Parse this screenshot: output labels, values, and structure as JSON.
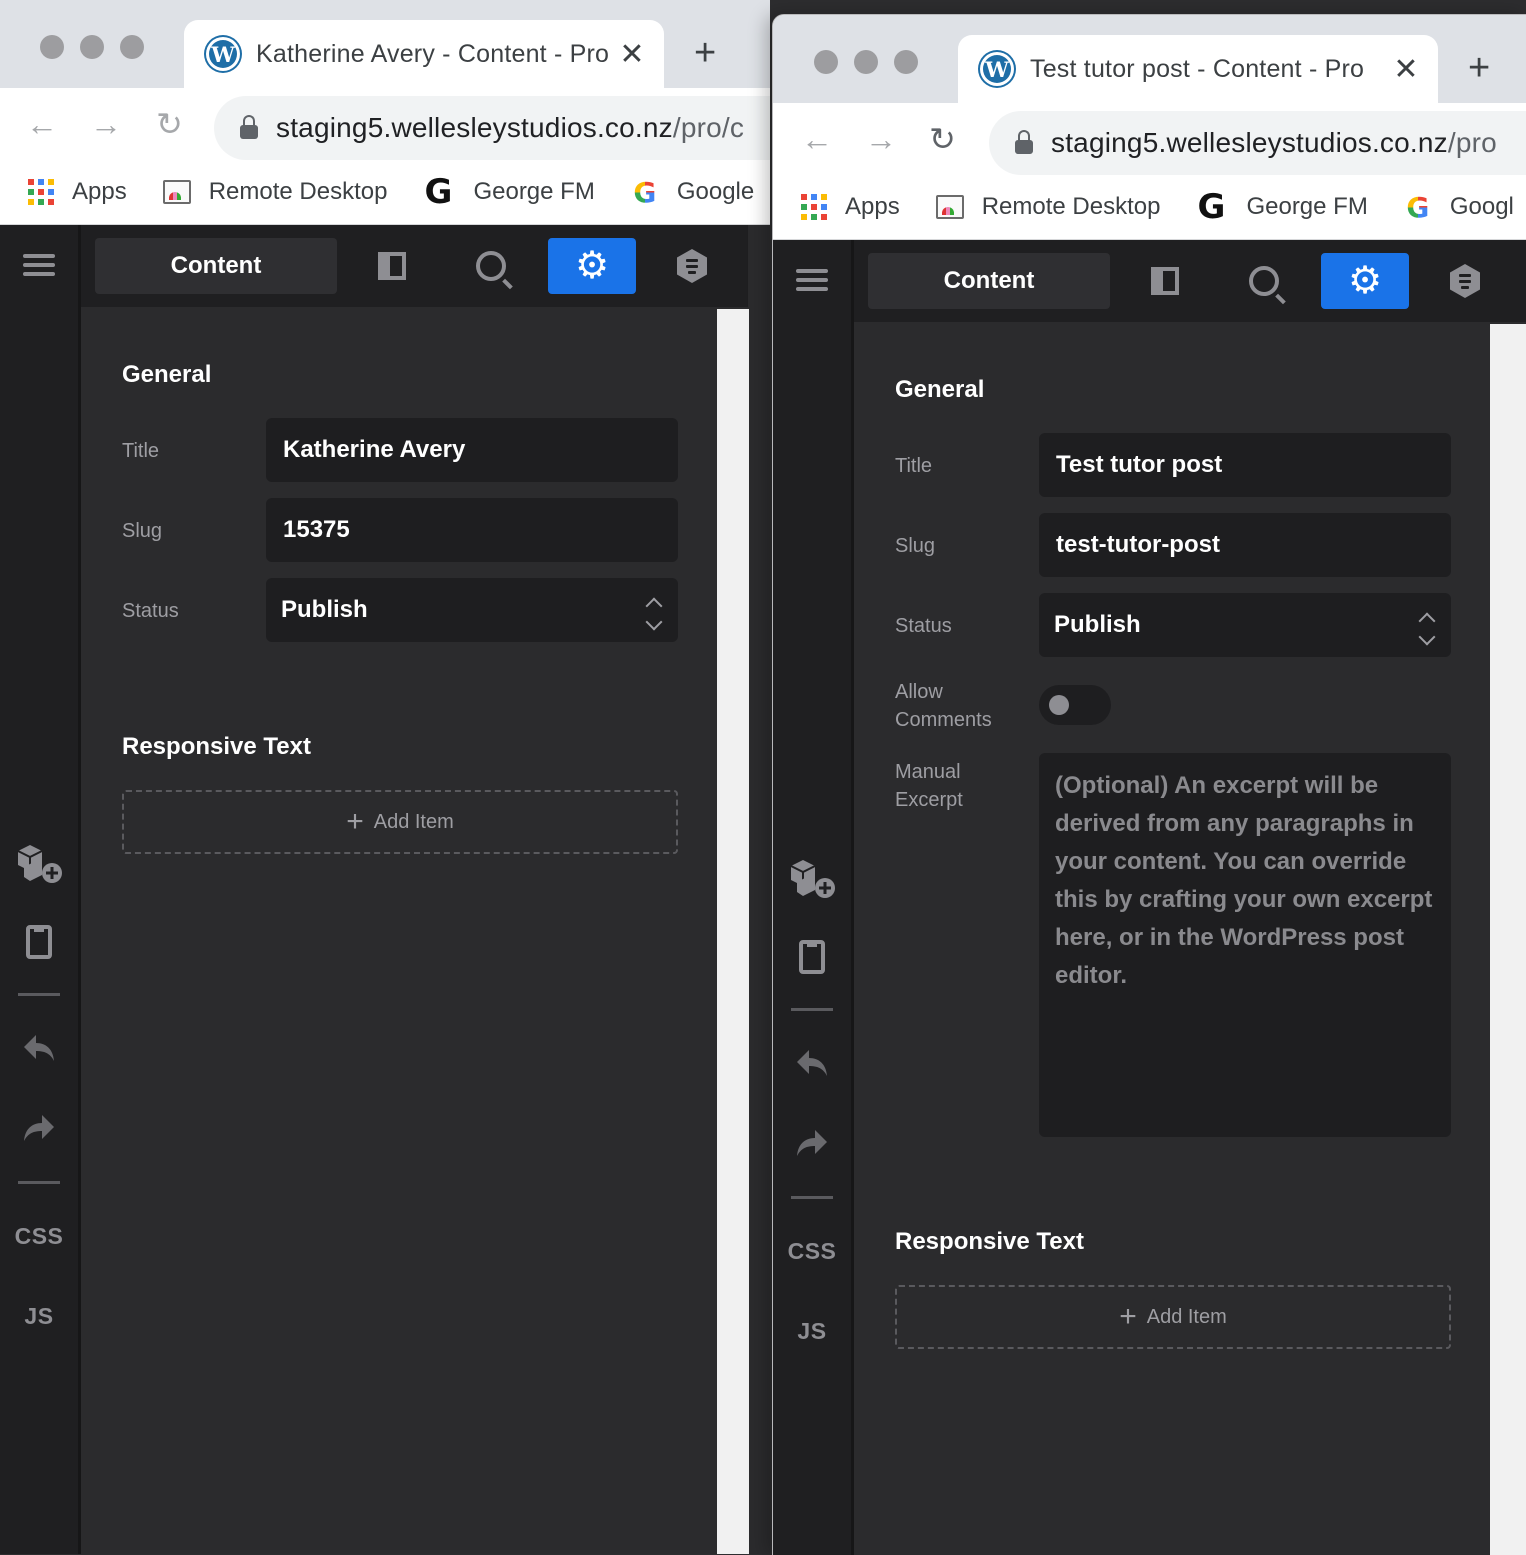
{
  "window_left": {
    "tab_title": "Katherine Avery - Content - Pro",
    "url_host": "staging5.wellesleystudios.co.nz",
    "url_path": "/pro/c",
    "bookmarks": [
      "Apps",
      "Remote Desktop",
      "George FM",
      "Google"
    ],
    "panel": {
      "tab_label": "Content",
      "general_title": "General",
      "title_label": "Title",
      "title_value": "Katherine Avery",
      "slug_label": "Slug",
      "slug_value": "15375",
      "status_label": "Status",
      "status_value": "Publish",
      "responsive_title": "Responsive Text",
      "add_item_label": "Add Item"
    }
  },
  "window_right": {
    "tab_title": "Test tutor post - Content - Pro",
    "url_host": "staging5.wellesleystudios.co.nz",
    "url_path": "/pro",
    "bookmarks": [
      "Apps",
      "Remote Desktop",
      "George FM",
      "Googl"
    ],
    "panel": {
      "tab_label": "Content",
      "general_title": "General",
      "title_label": "Title",
      "title_value": "Test tutor post",
      "slug_label": "Slug",
      "slug_value": "test-tutor-post",
      "status_label": "Status",
      "status_value": "Publish",
      "allow_comments_label_1": "Allow",
      "allow_comments_label_2": "Comments",
      "allow_comments_on": false,
      "excerpt_label_1": "Manual",
      "excerpt_label_2": "Excerpt",
      "excerpt_placeholder": "(Optional) An excerpt will be derived from any paragraphs in your content. You can override this by crafting your own excerpt here, or in the WordPress post editor.",
      "responsive_title": "Responsive Text",
      "add_item_label": "Add Item"
    }
  },
  "rail": {
    "css_label": "CSS",
    "js_label": "JS"
  },
  "icons": {
    "favicon": "wordpress-icon",
    "tab_close": "close-icon",
    "new_tab": "plus-icon",
    "back": "arrow-left-icon",
    "forward": "arrow-right-icon",
    "reload": "reload-icon",
    "lock": "lock-icon",
    "menu": "hamburger-icon",
    "layout": "layout-icon",
    "search": "search-icon",
    "settings": "gear-icon",
    "docs": "hexagon-doc-icon",
    "add_element": "cubes-plus-icon",
    "responsive": "tablet-icon",
    "undo": "undo-icon",
    "redo": "redo-icon"
  },
  "colors": {
    "accent": "#1a73e8",
    "panel_bg": "#2b2b2d",
    "rail_bg": "#1f1f21",
    "field_bg": "#1e1e20"
  }
}
